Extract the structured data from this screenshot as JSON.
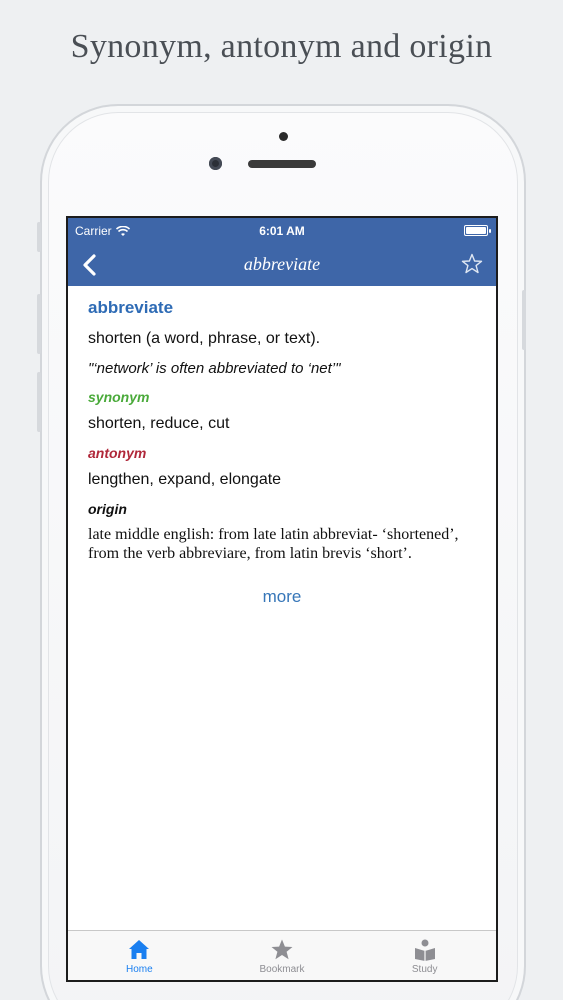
{
  "headline": "Synonym, antonym and origin",
  "status_bar": {
    "carrier": "Carrier",
    "time": "6:01 AM"
  },
  "nav": {
    "title": "abbreviate",
    "back_icon": "chevron-left-icon",
    "bookmark_icon": "star-outline-icon"
  },
  "entry": {
    "word": "abbreviate",
    "definition": "shorten (a word, phrase, or text).",
    "example": "\"‘network’ is often abbreviated to ‘net’\"",
    "synonym_label": "synonym",
    "synonyms": "shorten, reduce, cut",
    "antonym_label": "antonym",
    "antonyms": "lengthen, expand, elongate",
    "origin_label": "origin",
    "origin": "late middle english: from late latin abbreviat- ‘shortened’, from the verb abbreviare, from latin brevis ‘short’.",
    "more_link": "more"
  },
  "tabs": [
    {
      "label": "Home",
      "icon": "home-icon",
      "active": true
    },
    {
      "label": "Bookmark",
      "icon": "star-icon",
      "active": false
    },
    {
      "label": "Study",
      "icon": "study-icon",
      "active": false
    }
  ],
  "colors": {
    "accent": "#3e66a8",
    "word": "#2e6bb5",
    "synonym": "#4aaa3a",
    "antonym": "#b0283a",
    "tab_active": "#1a7ff0"
  }
}
